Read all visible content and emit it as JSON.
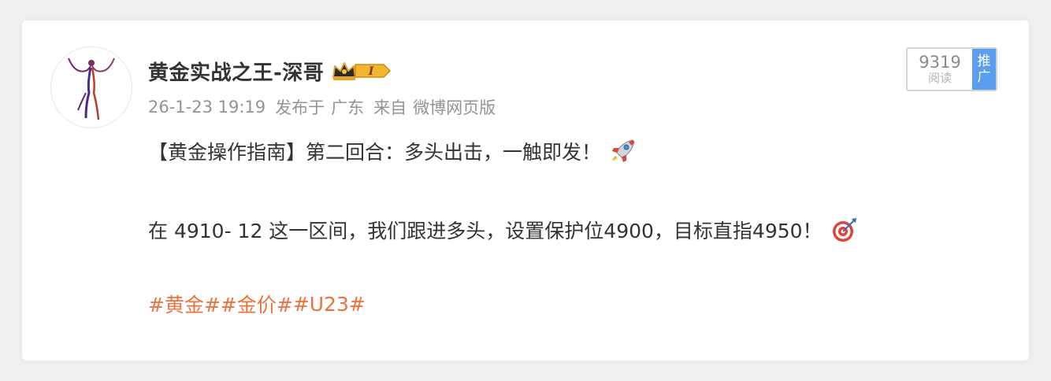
{
  "post": {
    "author": {
      "name": "黄金实战之王-深哥",
      "level": "I"
    },
    "meta": {
      "time": "26-1-23 19:19",
      "published_in_label": "发布于",
      "location": "广东",
      "source_label": "来自",
      "source": "微博网页版"
    },
    "stats": {
      "read_count": "9319",
      "read_label": "阅读",
      "promote_label_1": "推",
      "promote_label_2": "广"
    },
    "content": {
      "line1": "【黄金操作指南】第二回合：多头出击，一触即发！",
      "line1_emoji": "rocket-icon",
      "line2": "在 4910- 12 这一区间，我们跟进多头，设置保护位4900，目标直指4950！",
      "line2_emoji": "dart-target-icon"
    },
    "tags": [
      "#黄金#",
      "#金价#",
      "#U23#"
    ]
  },
  "colors": {
    "tag": "#eb7340",
    "promote_bg": "#5b9eed",
    "text_main": "#333333",
    "text_meta": "#939393"
  }
}
